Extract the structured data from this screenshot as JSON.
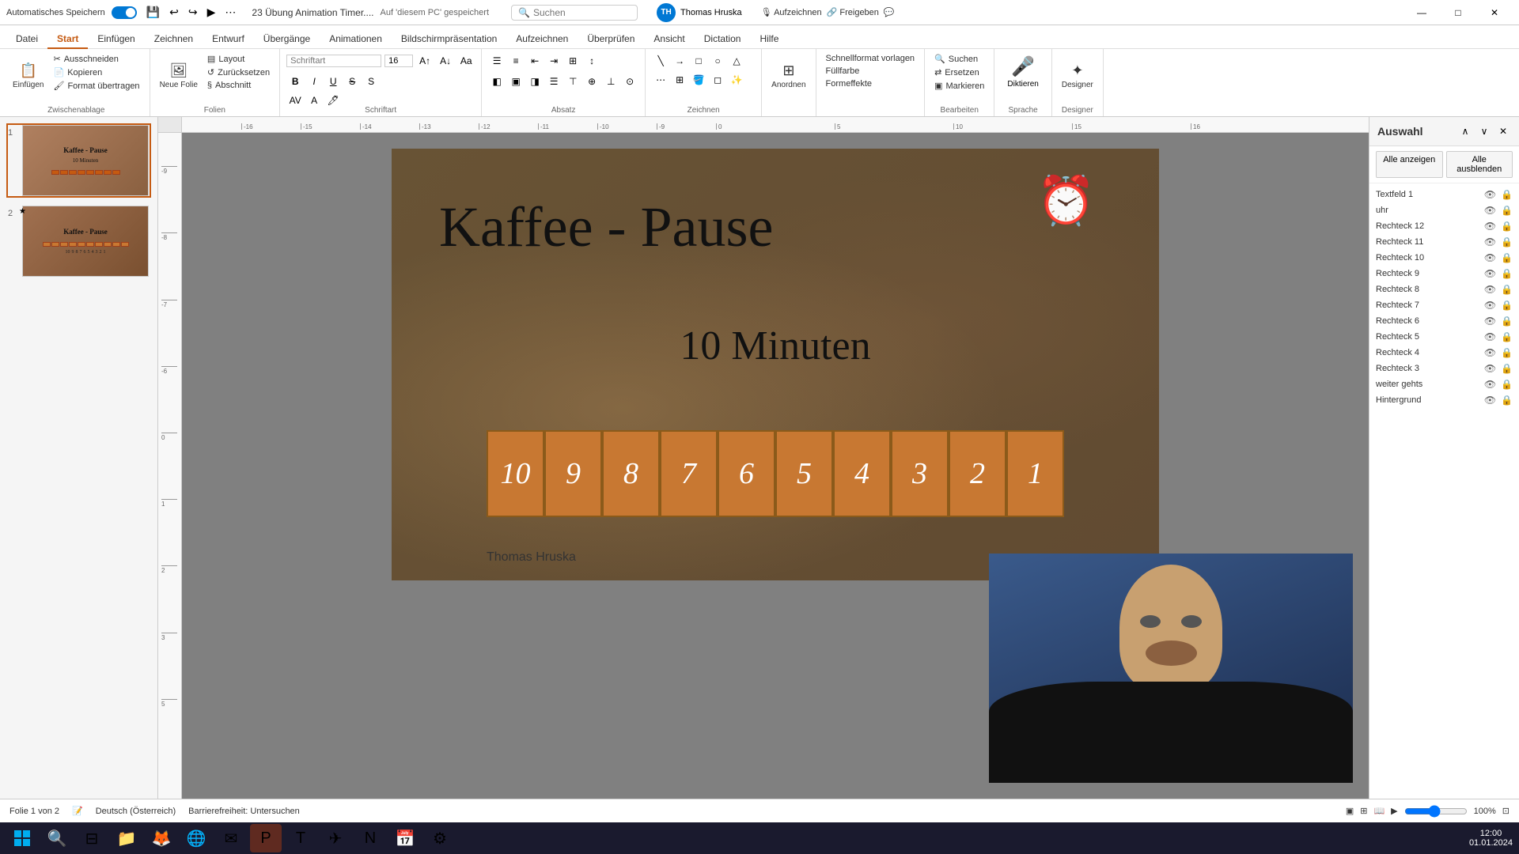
{
  "titlebar": {
    "autosave_label": "Automatisches Speichern",
    "file_name": "23 Übung Animation Timer....",
    "save_location": "Auf 'diesem PC' gespeichert",
    "search_placeholder": "Suchen",
    "user_name": "Thomas Hruska",
    "user_initials": "TH",
    "minimize_label": "—",
    "maximize_label": "□",
    "close_label": "✕"
  },
  "ribbon": {
    "tabs": [
      "Datei",
      "Start",
      "Einfügen",
      "Zeichnen",
      "Entwurf",
      "Übergänge",
      "Animationen",
      "Bildschirmpräsentation",
      "Aufzeichnen",
      "Überprüfen",
      "Ansicht",
      "Dictation",
      "Hilfe"
    ],
    "active_tab": "Start",
    "groups": {
      "clipboard": {
        "label": "Zwischenablage",
        "paste_btn": "Einfügen",
        "cut_btn": "Ausschneiden",
        "copy_btn": "Kopieren",
        "format_btn": "Format übertragen"
      },
      "slides": {
        "label": "Folien",
        "new_slide_btn": "Neue Folie",
        "layout_btn": "Layout",
        "reset_btn": "Zurücksetzen",
        "section_btn": "Abschnitt"
      },
      "font": {
        "label": "Schriftart",
        "font_family": "",
        "font_size": "16"
      },
      "paragraph": {
        "label": "Absatz"
      },
      "drawing": {
        "label": "Zeichnen"
      },
      "arrange": {
        "label": "Anordnen",
        "anordnen_btn": "Anordnen"
      },
      "quick_styles": {
        "label": "",
        "schnellformat_btn": "Schnellformat vorlagen"
      },
      "editing": {
        "label": "Bearbeiten",
        "suchen_btn": "Suchen",
        "ersetzen_btn": "Ersetzen",
        "markieren_btn": "Markieren"
      },
      "voice": {
        "label": "Sprache",
        "diktieren_btn": "Diktieren"
      },
      "designer": {
        "label": "Designer",
        "designer_btn": "Designer"
      }
    }
  },
  "slides_panel": {
    "slides": [
      {
        "num": "1",
        "title": "Kaffee - Pause",
        "subtitle": "10 Minuten",
        "active": true
      },
      {
        "num": "2",
        "title": "Kaffee - Pause",
        "subtitle": "",
        "active": false
      }
    ]
  },
  "main_slide": {
    "heading": "Kaffee - Pause",
    "subheading": "10 Minuten",
    "author": "Thomas Hruska",
    "timer_numbers": [
      "10",
      "9",
      "8",
      "7",
      "6",
      "5",
      "4",
      "3",
      "2",
      "1"
    ]
  },
  "selection_panel": {
    "title": "Auswahl",
    "show_all_btn": "Alle anzeigen",
    "hide_all_btn": "Alle ausblenden",
    "layers": [
      {
        "name": "Textfeld 1"
      },
      {
        "name": "uhr"
      },
      {
        "name": "Rechteck 12"
      },
      {
        "name": "Rechteck 11"
      },
      {
        "name": "Rechteck 10"
      },
      {
        "name": "Rechteck 9"
      },
      {
        "name": "Rechteck 8"
      },
      {
        "name": "Rechteck 7"
      },
      {
        "name": "Rechteck 6"
      },
      {
        "name": "Rechteck 5"
      },
      {
        "name": "Rechteck 4"
      },
      {
        "name": "Rechteck 3"
      },
      {
        "name": "weiter gehts"
      },
      {
        "name": "Hintergrund"
      }
    ]
  },
  "statusbar": {
    "slide_info": "Folie 1 von 2",
    "language": "Deutsch (Österreich)",
    "accessibility": "Barrierefreiheit: Untersuchen"
  },
  "taskbar": {
    "time": "12:00",
    "date": "01.01.2024"
  }
}
